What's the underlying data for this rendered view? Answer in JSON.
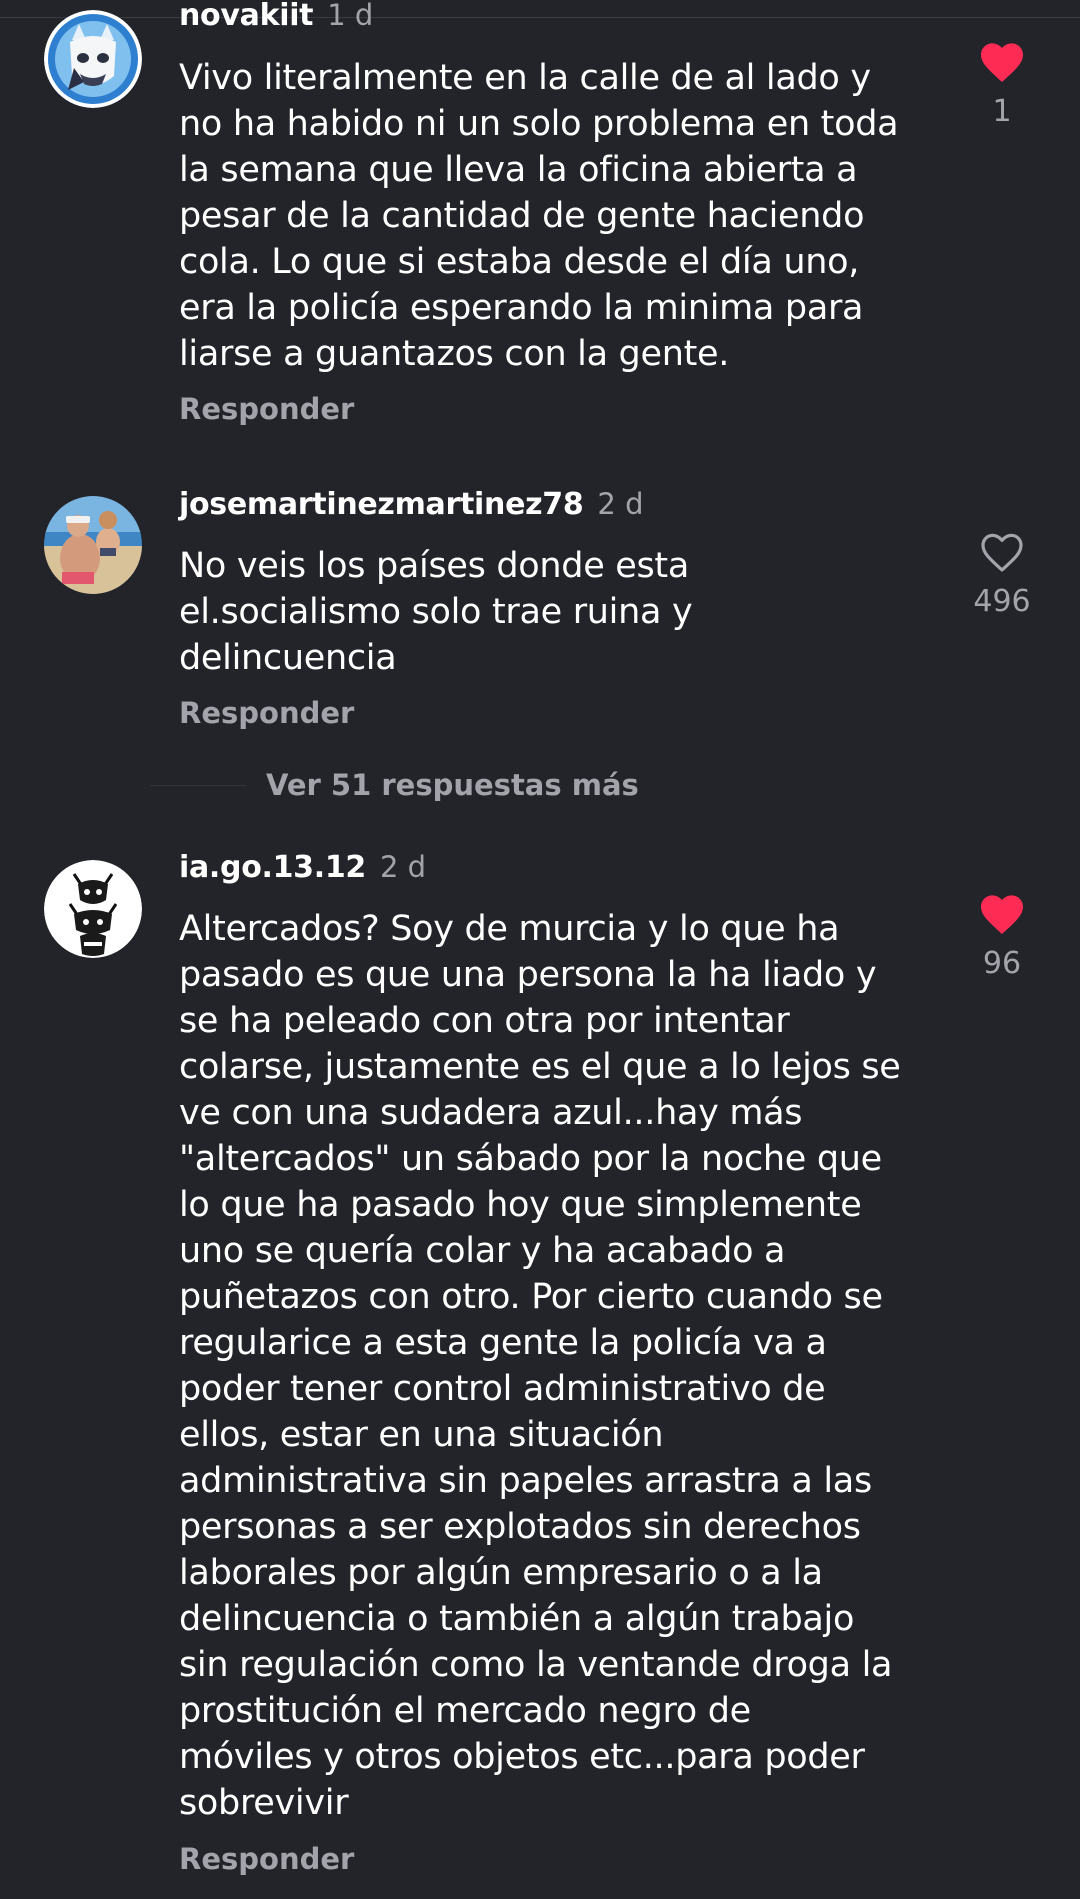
{
  "colors": {
    "background": "#23242a",
    "text": "#ffffff",
    "muted": "#a3a4ab",
    "like_active": "#fe2c55"
  },
  "comments": [
    {
      "username": "novakiit",
      "time": "1 d",
      "text": "Vivo literalmente en la calle de al lado y\nno ha habido ni un solo problema en toda\nla semana que lleva la oficina abierta a\npesar de la cantidad de gente haciendo\ncola. Lo que si estaba desde el día uno,\nera la policía esperando la minima para\nliarse a guantazos con la gente.",
      "reply_label": "Responder",
      "likes": "1",
      "liked": true,
      "like_icon": "heart-filled-icon"
    },
    {
      "username": "josemartinezmartinez78",
      "time": "2 d",
      "text": "No veis los países donde esta\nel.socialismo solo trae ruina y\ndelincuencia",
      "reply_label": "Responder",
      "likes": "496",
      "liked": false,
      "like_icon": "heart-outline-icon"
    },
    {
      "username": "ia.go.13.12",
      "time": "2 d",
      "text": "Altercados? Soy de murcia y lo que ha\npasado es que una persona la ha liado y\nse ha peleado con otra por intentar\ncolarse, justamente es el que a lo lejos se\nve con una sudadera azul...hay más\n\"altercados\" un sábado por la noche que\nlo que ha pasado hoy que simplemente\nuno se quería colar y ha acabado a\npuñetazos con otro. Por cierto cuando se\nregularice a esta gente la policía va a\npoder tener control administrativo de\nellos, estar en una situación\nadministrativa sin papeles arrastra a las\npersonas a ser explotados sin derechos\nlaborales por algún empresario o a la\ndelincuencia o también a algún trabajo\nsin regulación como la ventande droga la\nprostitución el mercado negro de\nmóviles y otros objetos etc...para poder\nsobrevivir",
      "reply_label": "Responder",
      "likes": "96",
      "liked": true,
      "like_icon": "heart-filled-icon"
    }
  ],
  "view_more_replies": "Ver 51 respuestas más"
}
